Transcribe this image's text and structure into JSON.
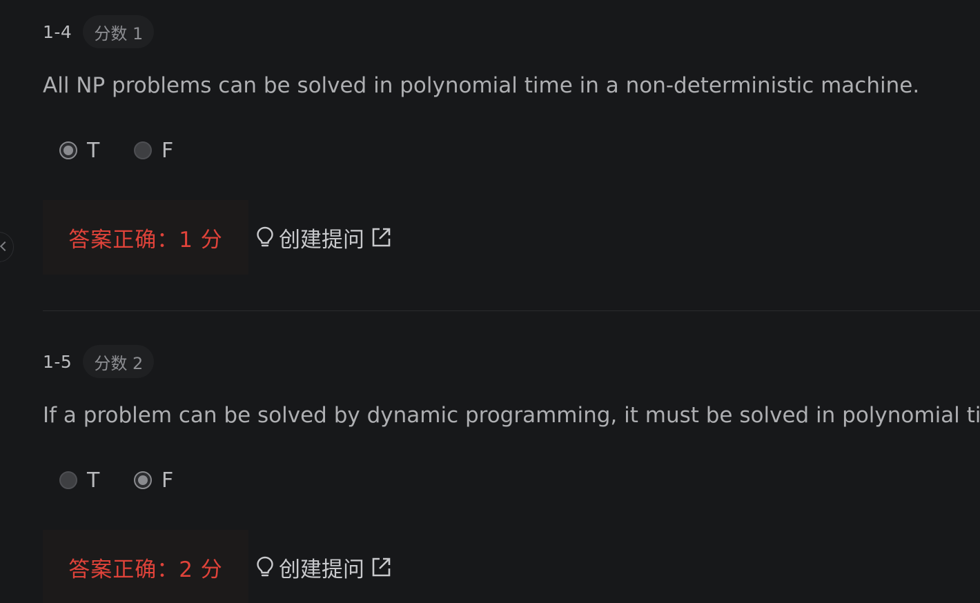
{
  "questions": [
    {
      "number": "1-4",
      "score_badge": "分数 1",
      "text": "All NP problems can be solved in polynomial time in a non-deterministic machine.",
      "options": [
        {
          "label": "T",
          "selected": true
        },
        {
          "label": "F",
          "selected": false
        }
      ],
      "result": "答案正确：1 分",
      "ask_label": "创建提问"
    },
    {
      "number": "1-5",
      "score_badge": "分数 2",
      "text": "If a problem can be solved by dynamic programming, it must be solved in polynomial time.",
      "options": [
        {
          "label": "T",
          "selected": false
        },
        {
          "label": "F",
          "selected": true
        }
      ],
      "result": "答案正确：2 分",
      "ask_label": "创建提问"
    }
  ],
  "colors": {
    "background": "#17181a",
    "result_text": "#e0433a",
    "result_bg": "#1c1a1a",
    "badge_bg": "#1f2022"
  },
  "icons": {
    "ask": "lightbulb-icon",
    "open": "external-link-icon",
    "sidebar_toggle": "chevron-left-icon"
  }
}
